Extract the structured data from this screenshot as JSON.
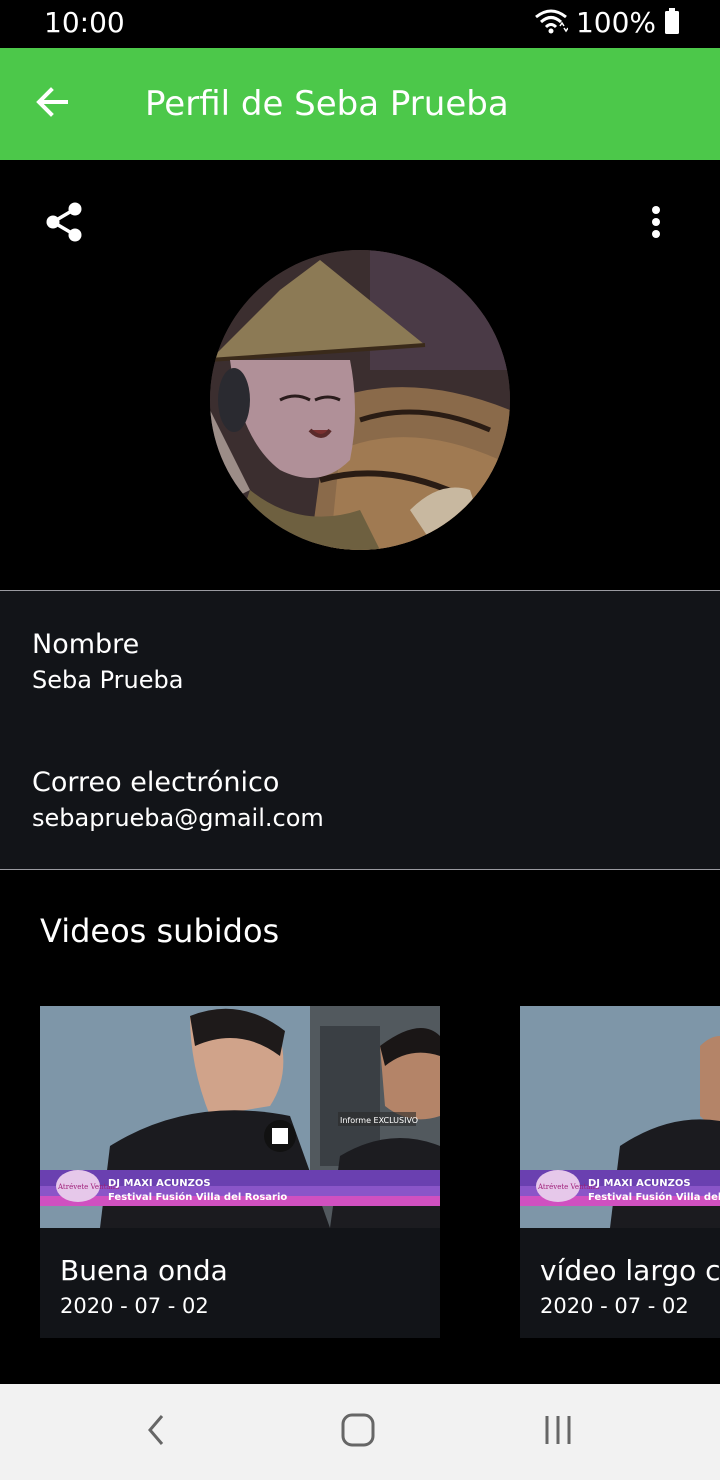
{
  "status_bar": {
    "time": "10:00",
    "battery": "100%",
    "icons": [
      "wifi-icon",
      "battery-icon"
    ]
  },
  "app_bar": {
    "title": "Perfil de Seba Prueba",
    "back_icon": "arrow-back-icon",
    "color": "#4cc84a"
  },
  "header": {
    "share_icon": "share-icon",
    "more_icon": "more-vert-icon"
  },
  "profile": {
    "name_label": "Nombre",
    "name_value": "Seba Prueba",
    "email_label": "Correo electrónico",
    "email_value": "sebaprueba@gmail.com"
  },
  "videos": {
    "section_title": "Videos subidos",
    "items": [
      {
        "title": "Buena onda",
        "date": "2020 - 07 - 02",
        "thumb_lines": [
          "DJ MAXI ACUNZOS",
          "Festival Fusión Villa del Rosario"
        ],
        "thumb_badge": "Informe EXCLUSIVO",
        "thumb_logo": "Atrévete Ventana"
      },
      {
        "title": "vídeo largo co",
        "date": "2020 - 07 - 02",
        "thumb_lines": [
          "DJ MAXI ACUNZOS",
          "Festival Fusión Villa del I"
        ],
        "thumb_logo": "Atrévete Ventana"
      }
    ]
  },
  "nav_bar": {
    "icons": [
      "back-nav-icon",
      "home-nav-icon",
      "recents-nav-icon"
    ]
  }
}
